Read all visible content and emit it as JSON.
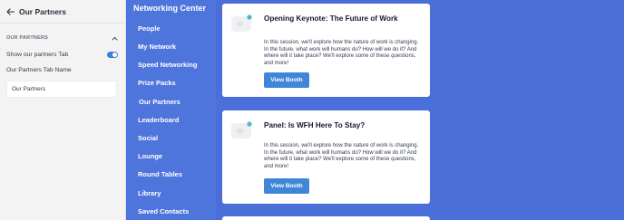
{
  "settings": {
    "title": "Our Partners",
    "section_label": "OUR PARTNERS",
    "toggle_label": "Show our partners Tab",
    "toggle_on": true,
    "tab_name_label": "Our Partners Tab Name",
    "tab_name_value": "Our Partners"
  },
  "nav": {
    "title": "Networking Center",
    "items": [
      {
        "label": "People"
      },
      {
        "label": "My Network"
      },
      {
        "label": "Speed Networking"
      },
      {
        "label": "Prize Packs"
      },
      {
        "label": "Our Partners"
      },
      {
        "label": "Leaderboard"
      },
      {
        "label": "Social"
      },
      {
        "label": "Lounge"
      },
      {
        "label": "Round Tables"
      },
      {
        "label": "Library"
      },
      {
        "label": "Saved Contacts"
      }
    ]
  },
  "cards": [
    {
      "title": "Opening Keynote: The Future of Work",
      "description": "In this session, we'll explore how the nature of work is changing. In the future, what work will humans do? How will we do it? And where will it take place? We'll explore some of these questions, and more!",
      "button_label": "View Booth"
    },
    {
      "title": "Panel: Is WFH Here To Stay?",
      "description": "In this session, we'll explore how the nature of work is changing. In the future, what work will humans do? How will we do it? And where will it take place? We'll explore some of these questions, and more!",
      "button_label": "View Booth"
    }
  ],
  "colors": {
    "background": "#4a6fd8",
    "button": "#3f86d8",
    "toggle": "#3a82d6",
    "thumb_dot": "#4fb8c9"
  }
}
